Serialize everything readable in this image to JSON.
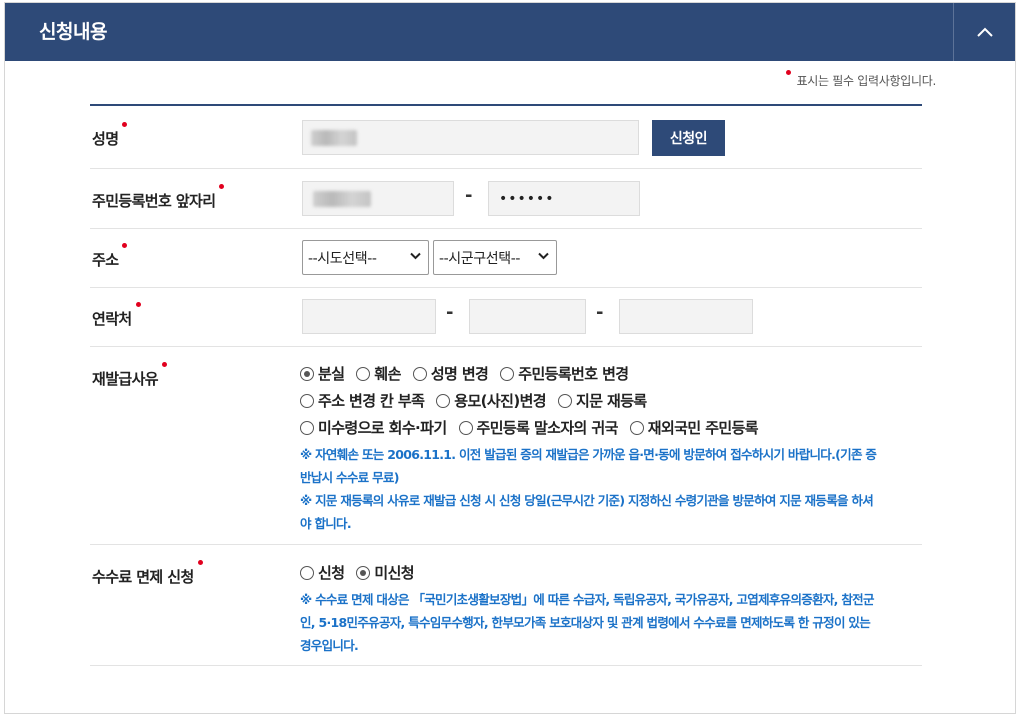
{
  "section": {
    "title": "신청내용"
  },
  "required_note": "표시는 필수 입력사항입니다.",
  "fields": {
    "name": {
      "label": "성명",
      "button": "신청인"
    },
    "rrn_front": {
      "label": "주민등록번호 앞자리",
      "separator": "-",
      "masked_value": "••••••"
    },
    "address": {
      "label": "주소",
      "sido": "--시도선택--",
      "sigungu": "--시군구선택--"
    },
    "contact": {
      "label": "연락처",
      "separator1": "-",
      "separator2": "-"
    },
    "reason": {
      "label": "재발급사유",
      "options_line1": [
        "분실",
        "훼손",
        "성명 변경",
        "주민등록번호 변경"
      ],
      "options_line2": [
        "주소 변경 칸 부족",
        "용모(사진)변경",
        "지문 재등록"
      ],
      "options_line3": [
        "미수령으로 회수·파기",
        "주민등록 말소자의 귀국",
        "재외국민 주민등록"
      ],
      "selected": "분실",
      "notice1_line1": "※ 자연훼손 또는 2006.11.1. 이전 발급된 증의 재발급은 가까운 읍·면·동에 방문하여 접수하시기 바랍니다.(기존 증",
      "notice1_line2": "반납시 수수료 무료)",
      "notice2_line1": "※ 지문 재등록의 사유로 재발급 신청 시 신청 당일(근무시간 기준) 지정하신 수령기관을 방문하여 지문 재등록을 하셔",
      "notice2_line2": "야 합니다."
    },
    "fee_exempt": {
      "label": "수수료 면제 신청",
      "options": [
        "신청",
        "미신청"
      ],
      "selected": "미신청",
      "notice_line1": "※ 수수료 면제 대상은 「국민기초생활보장법」에 따른 수급자, 독립유공자, 국가유공자, 고엽제후유의증환자, 참전군",
      "notice_line2": "인, 5·18민주유공자, 특수임무수행자, 한부모가족 보호대상자 및 관계 법령에서 수수료를 면제하도록 한 규정이 있는",
      "notice_line3": "경우입니다."
    }
  },
  "colors": {
    "navy": "#2e4a78",
    "required": "#e1001e",
    "notice_blue": "#1b72c8"
  },
  "icons": {
    "collapse": "chevron-up-icon",
    "dropdown": "chevron-down-icon"
  }
}
